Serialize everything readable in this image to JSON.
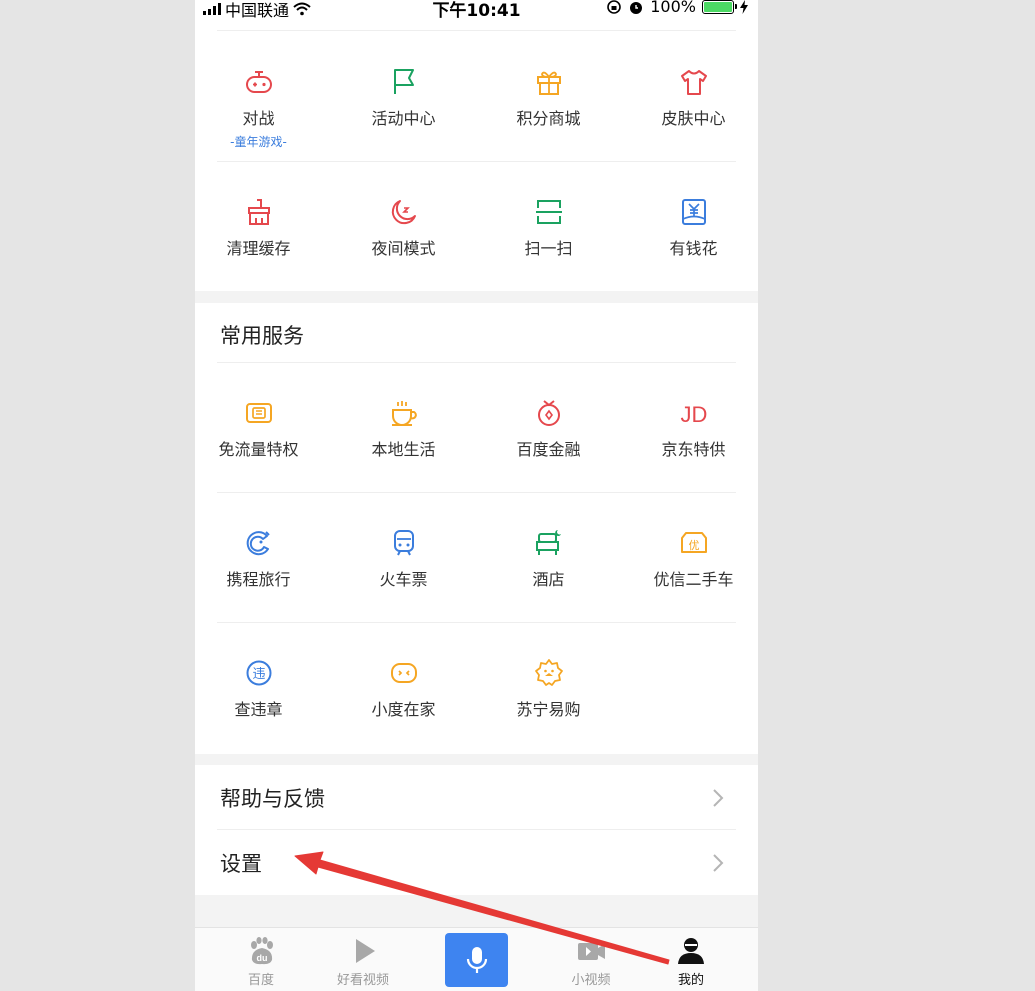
{
  "status_bar": {
    "carrier": "中国联通",
    "time": "下午10:41",
    "battery_percent": "100%",
    "battery_level": 1.0
  },
  "tools": [
    {
      "label": "对战",
      "sub": "-童年游戏-",
      "icon": "gamepad-icon",
      "color": "#e5484d"
    },
    {
      "label": "活动中心",
      "icon": "flag-icon",
      "color": "#1aa260"
    },
    {
      "label": "积分商城",
      "icon": "gift-icon",
      "color": "#f5a623"
    },
    {
      "label": "皮肤中心",
      "icon": "shirt-icon",
      "color": "#e5484d"
    },
    {
      "label": "清理缓存",
      "icon": "broom-icon",
      "color": "#e5484d"
    },
    {
      "label": "夜间模式",
      "icon": "moon-icon",
      "color": "#e5484d"
    },
    {
      "label": "扫一扫",
      "icon": "scan-icon",
      "color": "#1aa260"
    },
    {
      "label": "有钱花",
      "icon": "money-icon",
      "color": "#3b7ddd"
    }
  ],
  "services": {
    "title": "常用服务",
    "items": [
      {
        "label": "免流量特权",
        "icon": "card-icon",
        "color": "#f5a623"
      },
      {
        "label": "本地生活",
        "icon": "coffee-icon",
        "color": "#f5a623"
      },
      {
        "label": "百度金融",
        "icon": "coin-bag-icon",
        "color": "#e5484d"
      },
      {
        "label": "京东特供",
        "icon": "jd-logo-icon",
        "color": "#e5484d",
        "glyph": "JD"
      },
      {
        "label": "携程旅行",
        "icon": "dolphin-icon",
        "color": "#3b7ddd"
      },
      {
        "label": "火车票",
        "icon": "train-icon",
        "color": "#3b7ddd"
      },
      {
        "label": "酒店",
        "icon": "bed-icon",
        "color": "#1aa260"
      },
      {
        "label": "优信二手车",
        "icon": "car-icon",
        "color": "#f5a623",
        "glyph": "优"
      },
      {
        "label": "查违章",
        "icon": "violation-icon",
        "color": "#3b7ddd",
        "glyph": "违"
      },
      {
        "label": "小度在家",
        "icon": "xiaodu-icon",
        "color": "#f5a623"
      },
      {
        "label": "苏宁易购",
        "icon": "suning-icon",
        "color": "#f5a623"
      }
    ]
  },
  "menu": [
    {
      "label": "帮助与反馈"
    },
    {
      "label": "设置"
    }
  ],
  "tabbar": [
    {
      "label": "百度",
      "icon": "baidu-paw-icon"
    },
    {
      "label": "好看视频",
      "icon": "play-icon"
    },
    {
      "label": "",
      "icon": "microphone-icon"
    },
    {
      "label": "小视频",
      "icon": "video-camera-icon"
    },
    {
      "label": "我的",
      "icon": "user-icon",
      "active": true
    }
  ],
  "colors": {
    "accent_blue": "#3e84f0",
    "annotation_arrow": "#e53935"
  }
}
